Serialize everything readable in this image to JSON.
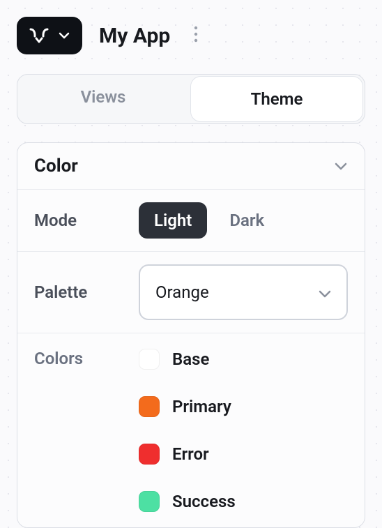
{
  "header": {
    "app_title": "My App"
  },
  "tabs": {
    "views_label": "Views",
    "theme_label": "Theme",
    "active": "Theme"
  },
  "color_section": {
    "title": "Color",
    "mode": {
      "label": "Mode",
      "light_label": "Light",
      "dark_label": "Dark",
      "selected": "Light"
    },
    "palette": {
      "label": "Palette",
      "selected": "Orange"
    },
    "colors": {
      "label": "Colors",
      "items": [
        {
          "name": "Base",
          "hex": "#ffffff"
        },
        {
          "name": "Primary",
          "hex": "#f36b1c"
        },
        {
          "name": "Error",
          "hex": "#ef2e2e"
        },
        {
          "name": "Success",
          "hex": "#4de0a3"
        }
      ]
    }
  }
}
